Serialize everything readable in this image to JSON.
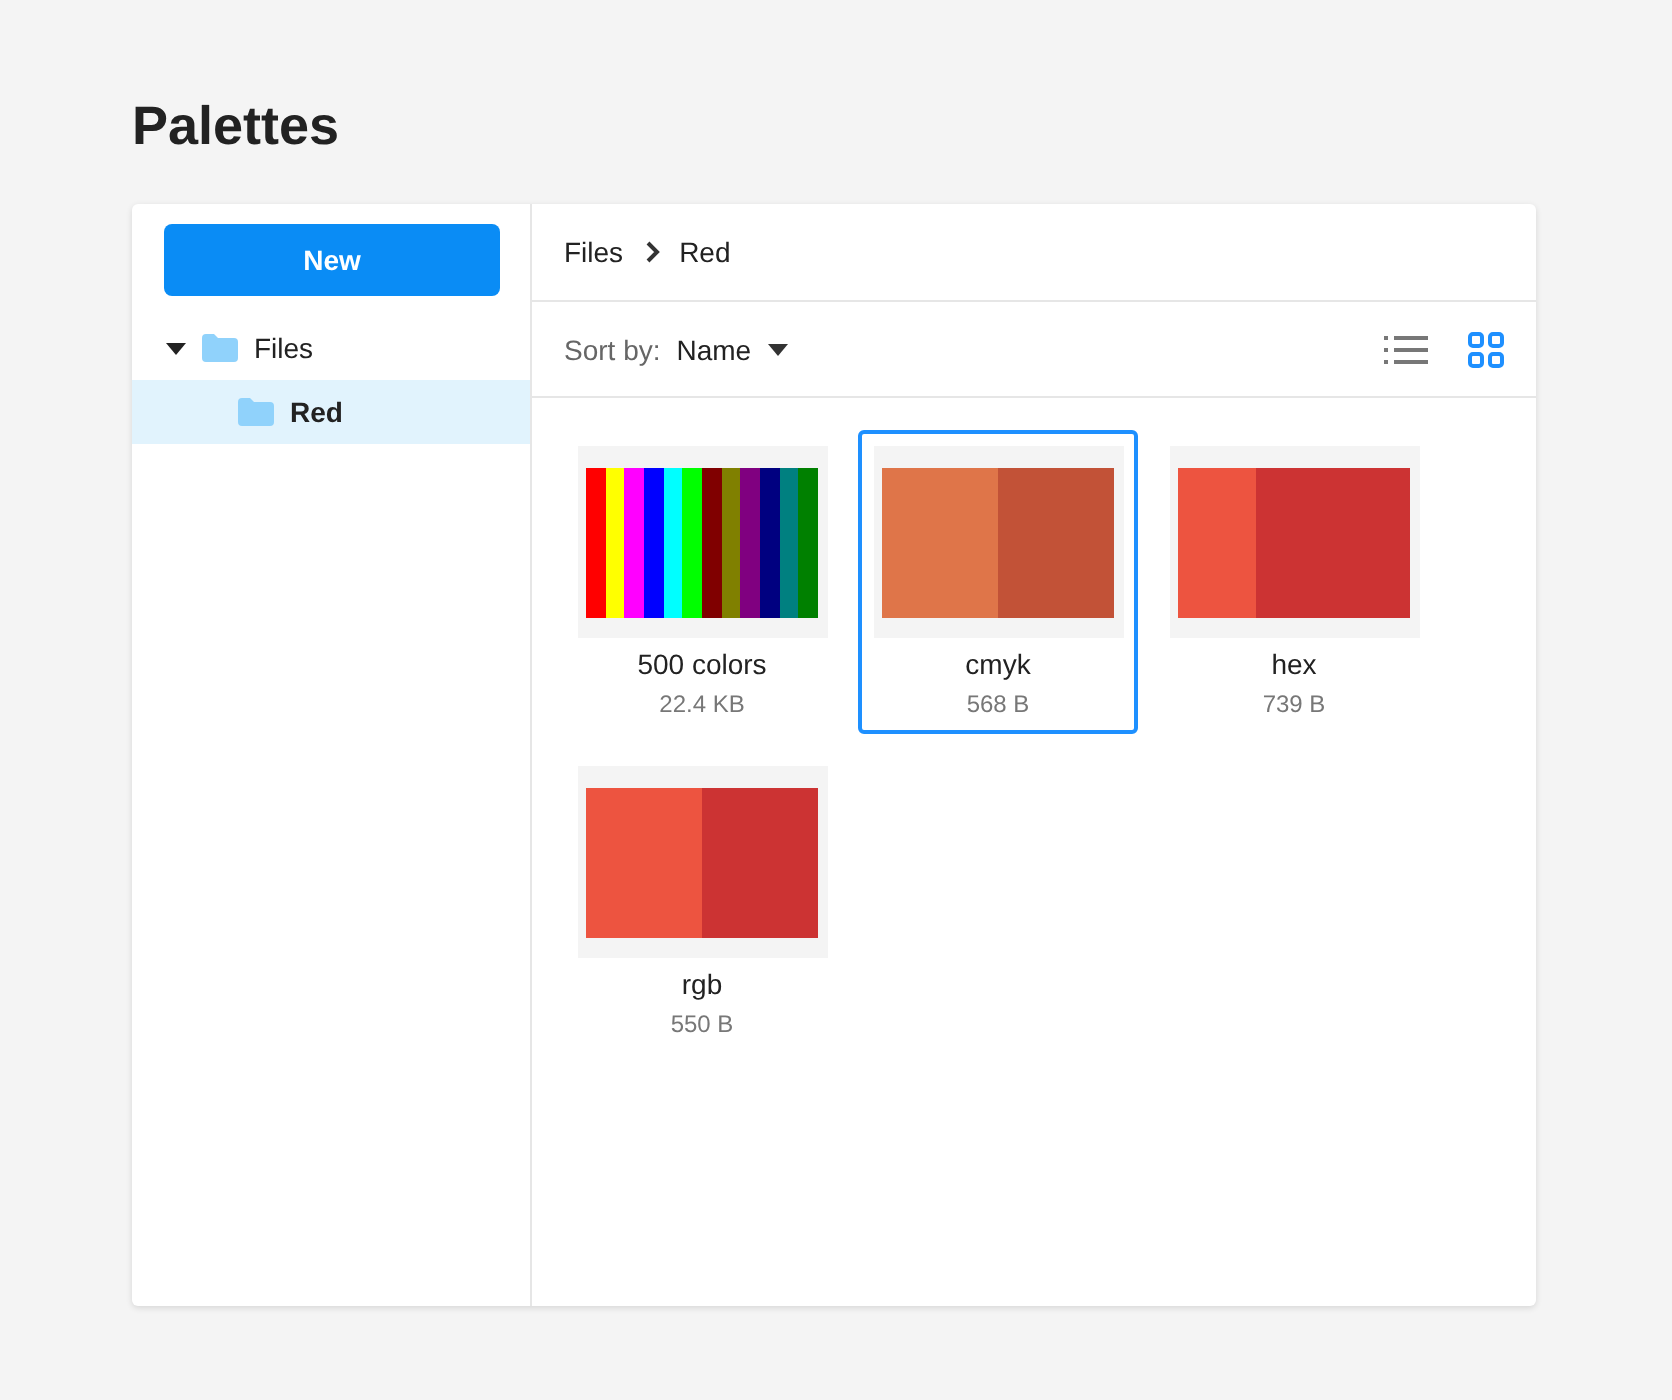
{
  "page": {
    "title": "Palettes"
  },
  "sidebar": {
    "new_button": "New",
    "tree": [
      {
        "label": "Files",
        "expanded": true,
        "selected": false,
        "children": [
          {
            "label": "Red",
            "selected": true
          }
        ]
      }
    ]
  },
  "breadcrumb": [
    "Files",
    "Red"
  ],
  "toolbar": {
    "sort_label": "Sort by:",
    "sort_value": "Name",
    "view": [
      {
        "kind": "list",
        "selected": false
      },
      {
        "kind": "grid",
        "selected": true
      }
    ]
  },
  "files": [
    {
      "name": "500 colors",
      "size": "22.4 KB",
      "selected": false,
      "swatches": [
        {
          "color": "#ff0000"
        },
        {
          "color": "#ffff00"
        },
        {
          "color": "#ff00ff"
        },
        {
          "color": "#0000ff"
        },
        {
          "color": "#00ffff"
        },
        {
          "color": "#00ff00"
        },
        {
          "color": "#800000"
        },
        {
          "color": "#808000"
        },
        {
          "color": "#800080"
        },
        {
          "color": "#000080"
        },
        {
          "color": "#008080"
        },
        {
          "color": "#008000"
        }
      ]
    },
    {
      "name": "cmyk",
      "size": "568 B",
      "selected": true,
      "swatches": [
        {
          "color": "#df7549"
        },
        {
          "color": "#c25237"
        }
      ]
    },
    {
      "name": "hex",
      "size": "739 B",
      "selected": false,
      "swatches": [
        {
          "color": "#ed5440"
        },
        {
          "color": "#cc3333"
        },
        {
          "color": "#cc3333"
        }
      ]
    },
    {
      "name": "rgb",
      "size": "550 B",
      "selected": false,
      "swatches": [
        {
          "color": "#ed5440"
        },
        {
          "color": "#cc3333"
        }
      ]
    }
  ]
}
